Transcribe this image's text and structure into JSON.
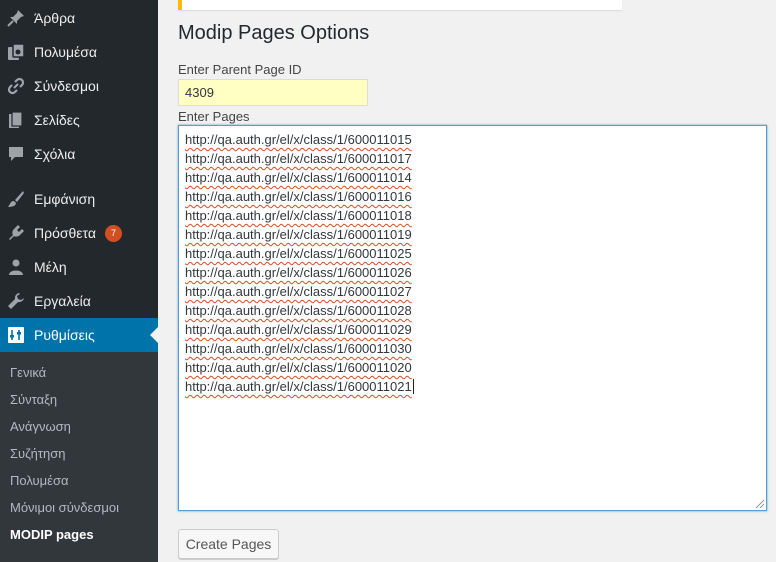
{
  "sidebar": {
    "items": [
      {
        "label": "Άρθρα",
        "icon": "pin-icon"
      },
      {
        "label": "Πολυμέσα",
        "icon": "media-icon"
      },
      {
        "label": "Σύνδεσμοι",
        "icon": "link-icon"
      },
      {
        "label": "Σελίδες",
        "icon": "pages-icon"
      },
      {
        "label": "Σχόλια",
        "icon": "comment-icon"
      },
      {
        "label": "Εμφάνιση",
        "icon": "brush-icon"
      },
      {
        "label": "Πρόσθετα",
        "icon": "plugin-icon",
        "badge": "7"
      },
      {
        "label": "Μέλη",
        "icon": "user-icon"
      },
      {
        "label": "Εργαλεία",
        "icon": "wrench-icon"
      },
      {
        "label": "Ρυθμίσεις",
        "icon": "settings-icon",
        "current": true
      }
    ],
    "submenu": [
      {
        "label": "Γενικά"
      },
      {
        "label": "Σύνταξη"
      },
      {
        "label": "Ανάγνωση"
      },
      {
        "label": "Συζήτηση"
      },
      {
        "label": "Πολυμέσα"
      },
      {
        "label": "Μόνιμοι σύνδεσμοι"
      },
      {
        "label": "MODIP pages",
        "current": true
      }
    ]
  },
  "main": {
    "title": "Modip Pages Options",
    "parent_label": "Enter Parent Page ID",
    "parent_value": "4309",
    "pages_label": "Enter Pages",
    "pages": [
      "http://qa.auth.gr/el/x/class/1/600011015",
      "http://qa.auth.gr/el/x/class/1/600011017",
      "http://qa.auth.gr/el/x/class/1/600011014",
      "http://qa.auth.gr/el/x/class/1/600011016",
      "http://qa.auth.gr/el/x/class/1/600011018",
      "http://qa.auth.gr/el/x/class/1/600011019",
      "http://qa.auth.gr/el/x/class/1/600011025",
      "http://qa.auth.gr/el/x/class/1/600011026",
      "http://qa.auth.gr/el/x/class/1/600011027",
      "http://qa.auth.gr/el/x/class/1/600011028",
      "http://qa.auth.gr/el/x/class/1/600011029",
      "http://qa.auth.gr/el/x/class/1/600011030",
      "http://qa.auth.gr/el/x/class/1/600011020",
      "http://qa.auth.gr/el/x/class/1/600011021"
    ],
    "button_label": "Create Pages"
  },
  "colors": {
    "sidebar_bg": "#23282d",
    "submenu_bg": "#32373c",
    "accent": "#0073aa",
    "badge": "#d54e21",
    "notice": "#ffb900",
    "input_highlight": "#ffffc4"
  }
}
